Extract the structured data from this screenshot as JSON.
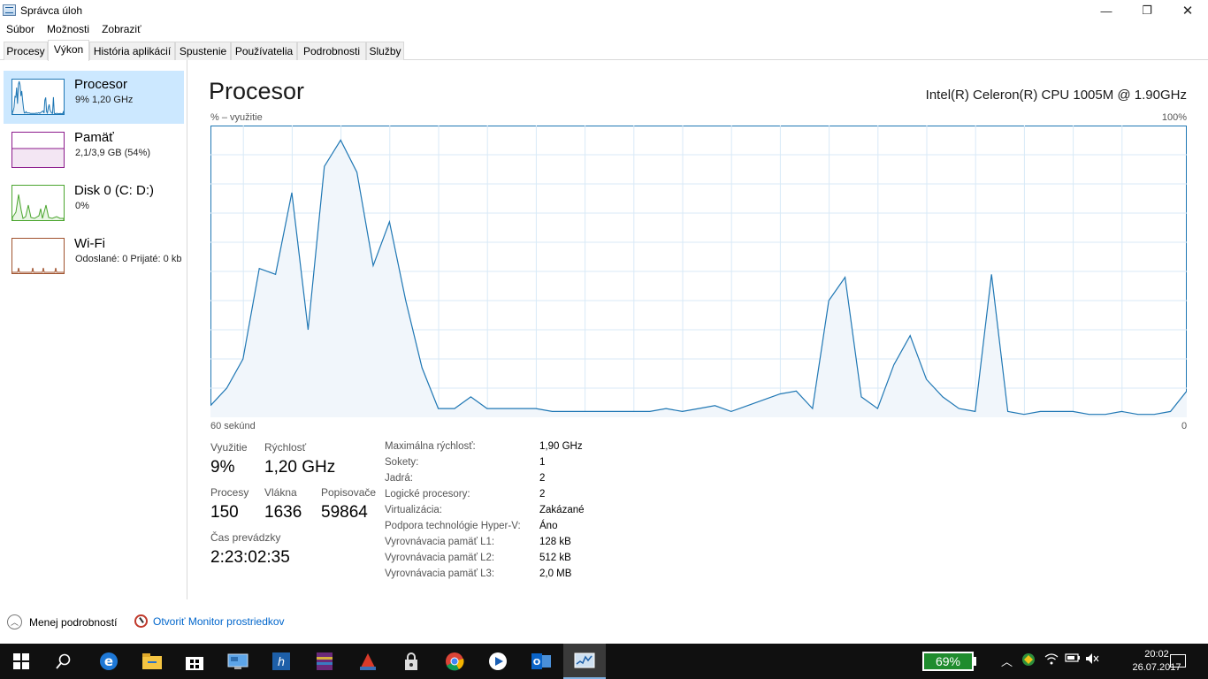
{
  "window": {
    "title": "Správca úloh",
    "controls": {
      "minimize": "—",
      "maximize": "❐",
      "close": "✕"
    }
  },
  "menu": [
    "Súbor",
    "Možnosti",
    "Zobraziť"
  ],
  "tabs": [
    "Procesy",
    "Výkon",
    "História aplikácií",
    "Spustenie",
    "Používatelia",
    "Podrobnosti",
    "Služby"
  ],
  "active_tab": "Výkon",
  "sidebar": {
    "items": [
      {
        "name": "Procesor",
        "detail": "9% 1,20 GHz",
        "color": "#1f77b4",
        "selected": true
      },
      {
        "name": "Pamäť",
        "detail": "2,1/3,9 GB (54%)",
        "color": "#8b1a8b",
        "selected": false
      },
      {
        "name": "Disk 0 (C: D:)",
        "detail": "0%",
        "color": "#4aa52e",
        "selected": false
      },
      {
        "name": "Wi-Fi",
        "detail": "Odoslané: 0 Prijaté: 0 kb",
        "color": "#a0522d",
        "selected": false
      }
    ]
  },
  "main": {
    "title": "Procesor",
    "cpu_name": "Intel(R) Celeron(R) CPU 1005M @ 1.90GHz",
    "graph_ylabel": "% – využitie",
    "graph_ymax_label": "100%",
    "graph_xlabel_left": "60 sekúnd",
    "graph_xlabel_right": "0"
  },
  "chart_data": {
    "type": "area",
    "title": "Procesor",
    "ylabel": "% – využitie",
    "xlabel": "60 sekúnd",
    "xlim": [
      60,
      0
    ],
    "ylim": [
      0,
      100
    ],
    "grid": true,
    "series": [
      {
        "values": [
          4,
          10,
          20,
          51,
          49,
          77,
          30,
          86,
          95,
          84,
          52,
          67,
          40,
          17,
          3,
          3,
          7,
          3,
          3,
          3,
          3,
          2,
          2,
          2,
          2,
          2,
          2,
          2,
          3,
          2,
          3,
          4,
          2,
          4,
          6,
          8,
          9,
          3,
          40,
          48,
          7,
          3,
          18,
          28,
          13,
          7,
          3,
          2,
          49,
          2,
          1,
          2,
          2,
          2,
          1,
          1,
          2,
          1,
          1,
          2,
          9
        ]
      }
    ],
    "color": "#1f77b4"
  },
  "stats": {
    "utilization_label": "Využitie",
    "utilization_value": "9%",
    "speed_label": "Rýchlosť",
    "speed_value": "1,20 GHz",
    "processes_label": "Procesy",
    "processes_value": "150",
    "threads_label": "Vlákna",
    "threads_value": "1636",
    "handles_label": "Popisovače",
    "handles_value": "59864",
    "uptime_label": "Čas prevádzky",
    "uptime_value": "2:23:02:35"
  },
  "specs": [
    {
      "label": "Maximálna rýchlosť:",
      "value": "1,90 GHz"
    },
    {
      "label": "Sokety:",
      "value": "1"
    },
    {
      "label": "Jadrá:",
      "value": "2"
    },
    {
      "label": "Logické procesory:",
      "value": "2"
    },
    {
      "label": "Virtualizácia:",
      "value": "Zakázané"
    },
    {
      "label": "Podpora technológie Hyper-V:",
      "value": "Áno"
    },
    {
      "label": "Vyrovnávacia pamäť L1:",
      "value": "128 kB"
    },
    {
      "label": "Vyrovnávacia pamäť L2:",
      "value": "512 kB"
    },
    {
      "label": "Vyrovnávacia pamäť L3:",
      "value": "2,0 MB"
    }
  ],
  "footer": {
    "fewer_details": "Menej podrobností",
    "open_monitor": "Otvoriť Monitor prostriedkov"
  },
  "taskbar": {
    "battery": "69%",
    "time": "20:02",
    "date": "26.07.2017",
    "apps": [
      "windows-start-icon",
      "search-icon",
      "edge-icon",
      "file-explorer-icon",
      "store-icon",
      "remote-desktop-icon",
      "hp-icon",
      "winrar-icon",
      "ccleaner-icon",
      "lock-icon",
      "chrome-icon",
      "media-player-icon",
      "outlook-icon",
      "task-manager-icon"
    ]
  }
}
